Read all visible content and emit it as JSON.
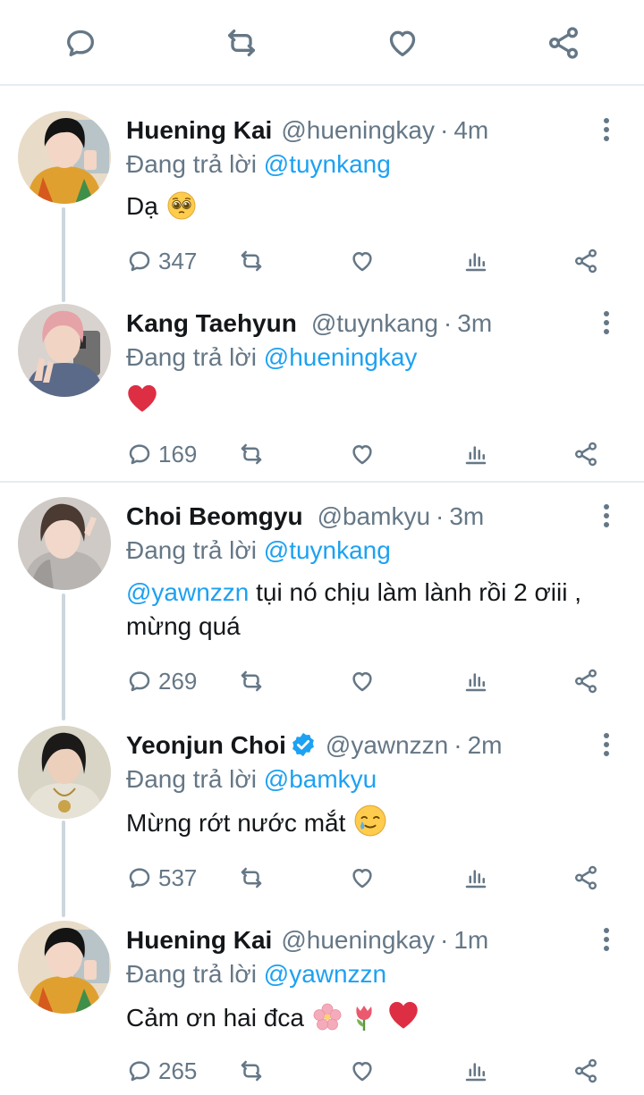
{
  "top_actions": {
    "icons": [
      "reply-icon",
      "retweet-icon",
      "like-icon",
      "share-icon"
    ]
  },
  "colors": {
    "accent": "#1da1f2",
    "text": "#14171a",
    "muted": "#657786",
    "divider": "#e6ecf0",
    "heart": "#e0245e"
  },
  "tweets": [
    {
      "name": "Huening Kai",
      "handle": "@hueningkay",
      "separator": "·",
      "time": "4m",
      "reply_prefix": "Đang trả lời",
      "reply_to": "@tuynkang",
      "text": "Dạ",
      "emoji": [
        "pleading-face"
      ],
      "reply_count": "347"
    },
    {
      "name": "Kang Taehyun",
      "handle": "@tuynkang",
      "separator": "·",
      "time": "3m",
      "reply_prefix": "Đang trả lời",
      "reply_to": "@hueningkay",
      "text": "",
      "emoji": [
        "red-heart"
      ],
      "reply_count": "169"
    },
    {
      "name": "Choi Beomgyu",
      "handle": "@bamkyu",
      "separator": "·",
      "time": "3m",
      "reply_prefix": "Đang trả lời",
      "reply_to": "@tuynkang",
      "text_mention": "@yawnzzn",
      "text": "tụi nó chịu làm lành rồi 2 ơiii , mừng quá",
      "reply_count": "269"
    },
    {
      "name": "Yeonjun Choi",
      "handle": "@yawnzzn",
      "separator": "·",
      "time": "2m",
      "verified": true,
      "reply_prefix": "Đang trả lời",
      "reply_to": "@bamkyu",
      "text": "Mừng rớt nước mắt",
      "emoji": [
        "smiling-face-with-tear"
      ],
      "reply_count": "537"
    },
    {
      "name": "Huening Kai",
      "handle": "@hueningkay",
      "separator": "·",
      "time": "1m",
      "reply_prefix": "Đang trả lời",
      "reply_to": "@yawnzzn",
      "text": "Cảm ơn hai đca",
      "emoji": [
        "cherry-blossom",
        "tulip",
        "red-heart"
      ],
      "reply_count": "265"
    }
  ]
}
